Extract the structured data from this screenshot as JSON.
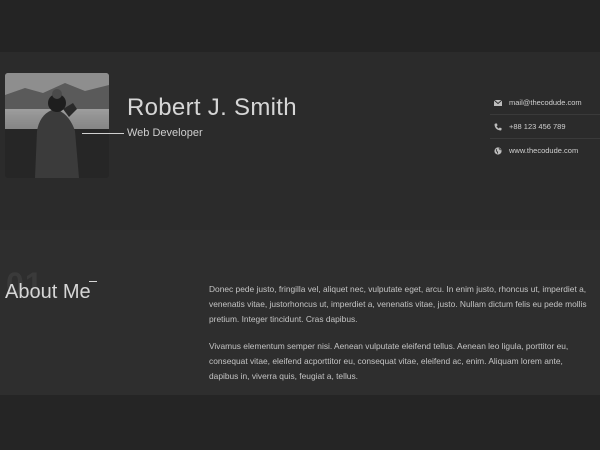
{
  "header": {
    "name": "Robert J. Smith",
    "role": "Web Developer",
    "contacts": [
      {
        "icon": "envelope-icon",
        "text": "mail@thecodude.com"
      },
      {
        "icon": "phone-icon",
        "text": "+88 123 456 789"
      },
      {
        "icon": "globe-icon",
        "text": "www.thecodude.com"
      }
    ]
  },
  "about": {
    "number": "01",
    "title": "About Me",
    "paragraphs": [
      "Donec pede justo, fringilla vel, aliquet nec, vulputate eget, arcu. In enim justo, rhoncus ut, imperdiet a, venenatis vitae, justorhoncus ut, imperdiet a, venenatis vitae, justo. Nullam dictum felis eu pede mollis pretium. Integer tincidunt. Cras dapibus.",
      "Vivamus elementum semper nisi. Aenean vulputate eleifend tellus. Aenean leo ligula, porttitor eu, consequat vitae, eleifend acporttitor eu, consequat vitae, eleifend ac, enim. Aliquam lorem ante, dapibus in, viverra quis, feugiat a, tellus."
    ]
  },
  "colors": {
    "background": "#262626",
    "header_band": "#2b2b2b",
    "about_band": "#2e2e2e",
    "text": "#d6d6d6"
  }
}
